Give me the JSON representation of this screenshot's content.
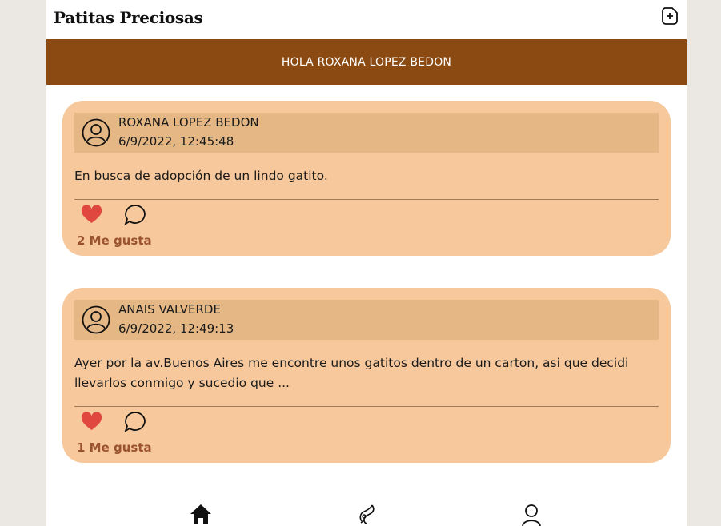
{
  "header": {
    "logo": "Patitas Preciosas",
    "new_post_icon": "new-post-icon"
  },
  "banner": {
    "greeting": "HOLA ROXANA LOPEZ BEDON"
  },
  "posts": [
    {
      "author": "ROXANA LOPEZ BEDON",
      "timestamp": "6/9/2022, 12:45:48",
      "text": "En busca de adopción de un lindo gatito.",
      "likes_label": "2 Me gusta"
    },
    {
      "author": "ANAIS VALVERDE",
      "timestamp": "6/9/2022, 12:49:13",
      "text": "Ayer por la av.Buenos Aires me encontre unos gatitos dentro de un carton, asi que decidi llevarlos conmigo y sucedio que ...",
      "likes_label": "1 Me gusta"
    }
  ],
  "nav": {
    "items": [
      "home-icon",
      "pet-icon",
      "user-icon"
    ]
  },
  "colors": {
    "banner": "#8b4a12",
    "card": "#f6c89b",
    "card_header": "#e4b784",
    "like": "#e0473f",
    "likes_text": "#9a5230"
  }
}
